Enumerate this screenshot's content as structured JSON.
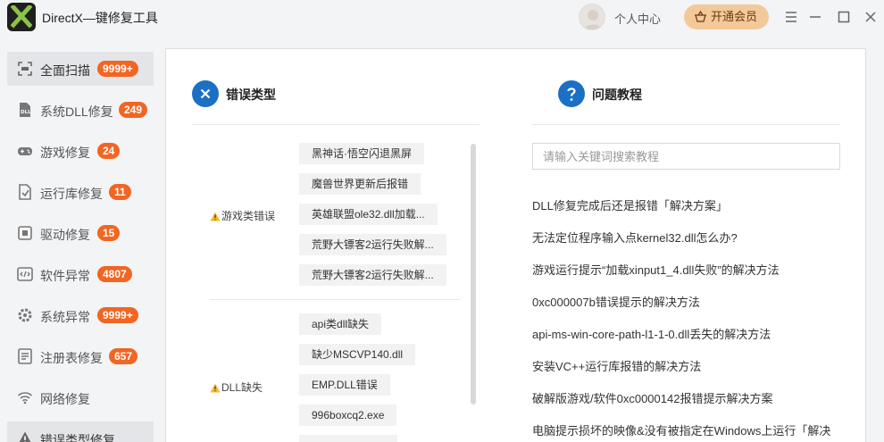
{
  "app": {
    "title": "DirectX—键修复工具"
  },
  "header": {
    "user_center": "个人中心",
    "vip_label": "开通会员"
  },
  "sidebar": {
    "items": [
      {
        "label": "全面扫描",
        "badge": "9999+",
        "icon": "scan-icon"
      },
      {
        "label": "系统DLL修复",
        "badge": "249",
        "icon": "dll-icon"
      },
      {
        "label": "游戏修复",
        "badge": "24",
        "icon": "gamepad-icon"
      },
      {
        "label": "运行库修复",
        "badge": "11",
        "icon": "runtime-icon"
      },
      {
        "label": "驱动修复",
        "badge": "15",
        "icon": "driver-icon"
      },
      {
        "label": "软件异常",
        "badge": "4807",
        "icon": "code-icon"
      },
      {
        "label": "系统异常",
        "badge": "9999+",
        "icon": "gear-icon"
      },
      {
        "label": "注册表修复",
        "badge": "657",
        "icon": "registry-icon"
      },
      {
        "label": "网络修复",
        "badge": "",
        "icon": "wifi-icon"
      },
      {
        "label": "错误类型修复",
        "badge": "",
        "icon": "warning-icon"
      }
    ]
  },
  "errors": {
    "title": "错误类型",
    "groups": [
      {
        "label": "游戏类错误",
        "items": [
          "黑神话·悟空闪退黑屏",
          "魔兽世界更新后报错",
          "英雄联盟ole32.dll加载...",
          "荒野大镖客2运行失败解...",
          "荒野大镖客2运行失败解..."
        ]
      },
      {
        "label": "DLL缺失",
        "items": [
          "api类dll缺失",
          "缺少MSCVP140.dll",
          "EMP.DLL错误",
          "996boxcq2.exe"
        ]
      }
    ]
  },
  "tutorials": {
    "title": "问题教程",
    "search_placeholder": "请输入关键词搜索教程",
    "links": [
      "DLL修复完成后还是报错「解决方案」",
      "无法定位程序输入点kernel32.dll怎么办?",
      "游戏运行提示“加载xinput1_4.dll失败”的解决方法",
      "0xc000007b错误提示的解决方法",
      "api-ms-win-core-path-l1-1-0.dll丢失的解决方法",
      "安装VC++运行库报错的解决方法",
      "破解版游戏/软件0xc0000142报错提示解决方案",
      "电脑提示损坏的映像&没有被指定在Windows上运行「解决方案」"
    ]
  },
  "colors": {
    "accent": "#1b6fc5",
    "badge": "#f26522",
    "vip": "#f4c99a",
    "logo_green": "#8bc34a"
  }
}
